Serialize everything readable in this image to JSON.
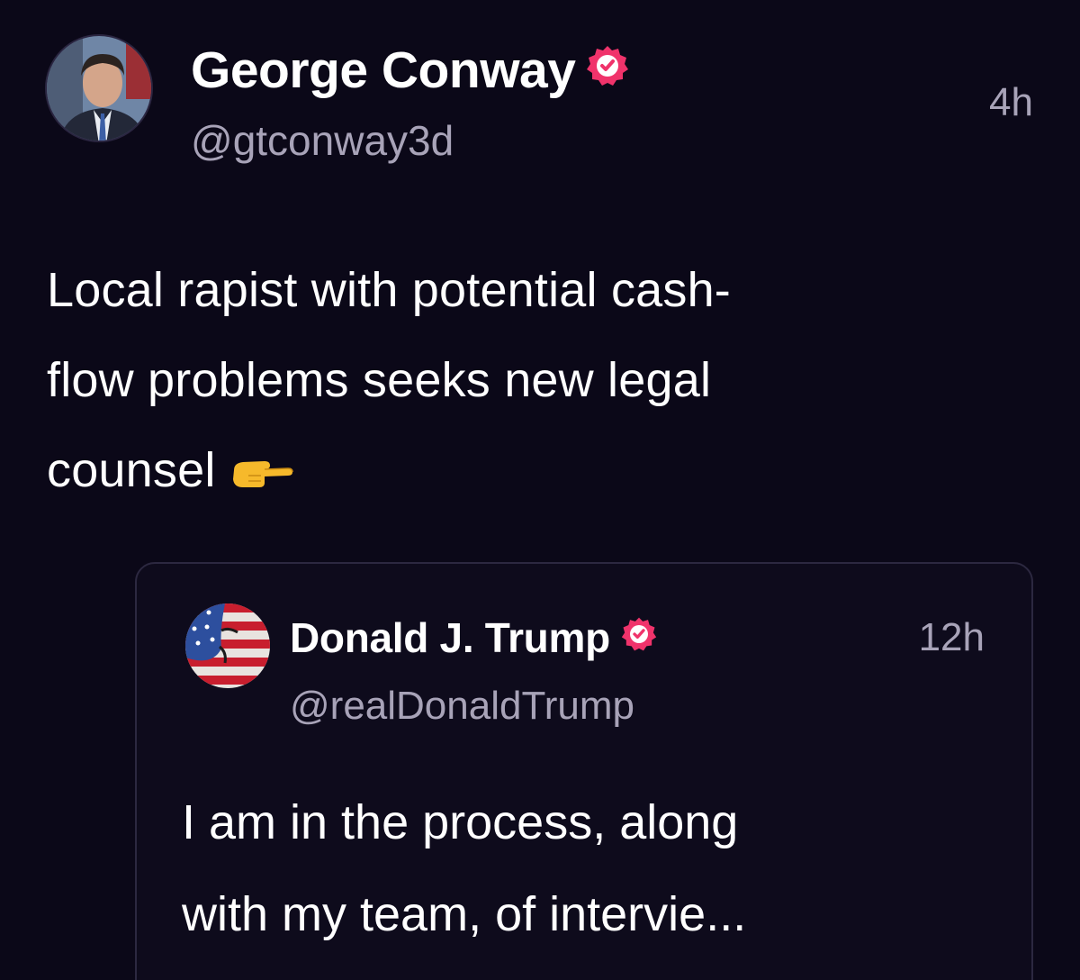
{
  "post": {
    "author": {
      "name": "George Conway",
      "handle": "@gtconway3d",
      "verified": true,
      "avatar": "person-in-suit-avatar"
    },
    "timestamp": "4h",
    "text_lines": [
      "Local rapist with potential cash-",
      "flow problems seeks new legal",
      "counsel"
    ],
    "emoji": "backhand-index-pointing-right-icon"
  },
  "quoted_post": {
    "author": {
      "name": "Donald J. Trump",
      "handle": "@realDonaldTrump",
      "verified": true,
      "avatar": "flag-face-avatar"
    },
    "timestamp": "12h",
    "text_lines": [
      "I am in the process, along",
      "with my team, of intervie..."
    ]
  },
  "colors": {
    "background": "#0b0818",
    "text": "#ffffff",
    "secondary_text": "#a8a3b8",
    "verified_badge": "#f0336b",
    "card_border": "#2c2840"
  }
}
